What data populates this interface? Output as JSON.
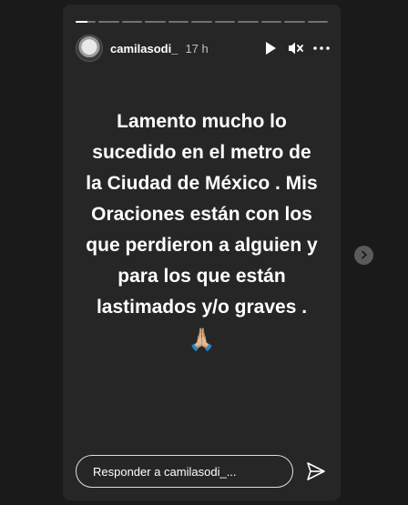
{
  "story": {
    "progress": {
      "segments": 11,
      "active_index": 0,
      "active_fraction": 0.6
    },
    "header": {
      "username": "camilasodi_",
      "time": "17 h",
      "icons": {
        "play": "play-icon",
        "mute": "muted-speaker-icon",
        "more": "more-options-icon"
      }
    },
    "message": {
      "text": "Lamento mucho lo sucedido en el metro de la Ciudad de México . Mis Oraciones están con los que perdieron a alguien y para los que están lastimados y/o graves .",
      "emoji": "🙏🏼"
    },
    "reply": {
      "placeholder": "Responder a camilasodi_..."
    },
    "send_icon": "send-icon"
  },
  "navigation": {
    "next_icon": "chevron-right-icon"
  },
  "colors": {
    "background": "#1a1a1a",
    "story_background": "#262626",
    "text": "#ffffff"
  }
}
